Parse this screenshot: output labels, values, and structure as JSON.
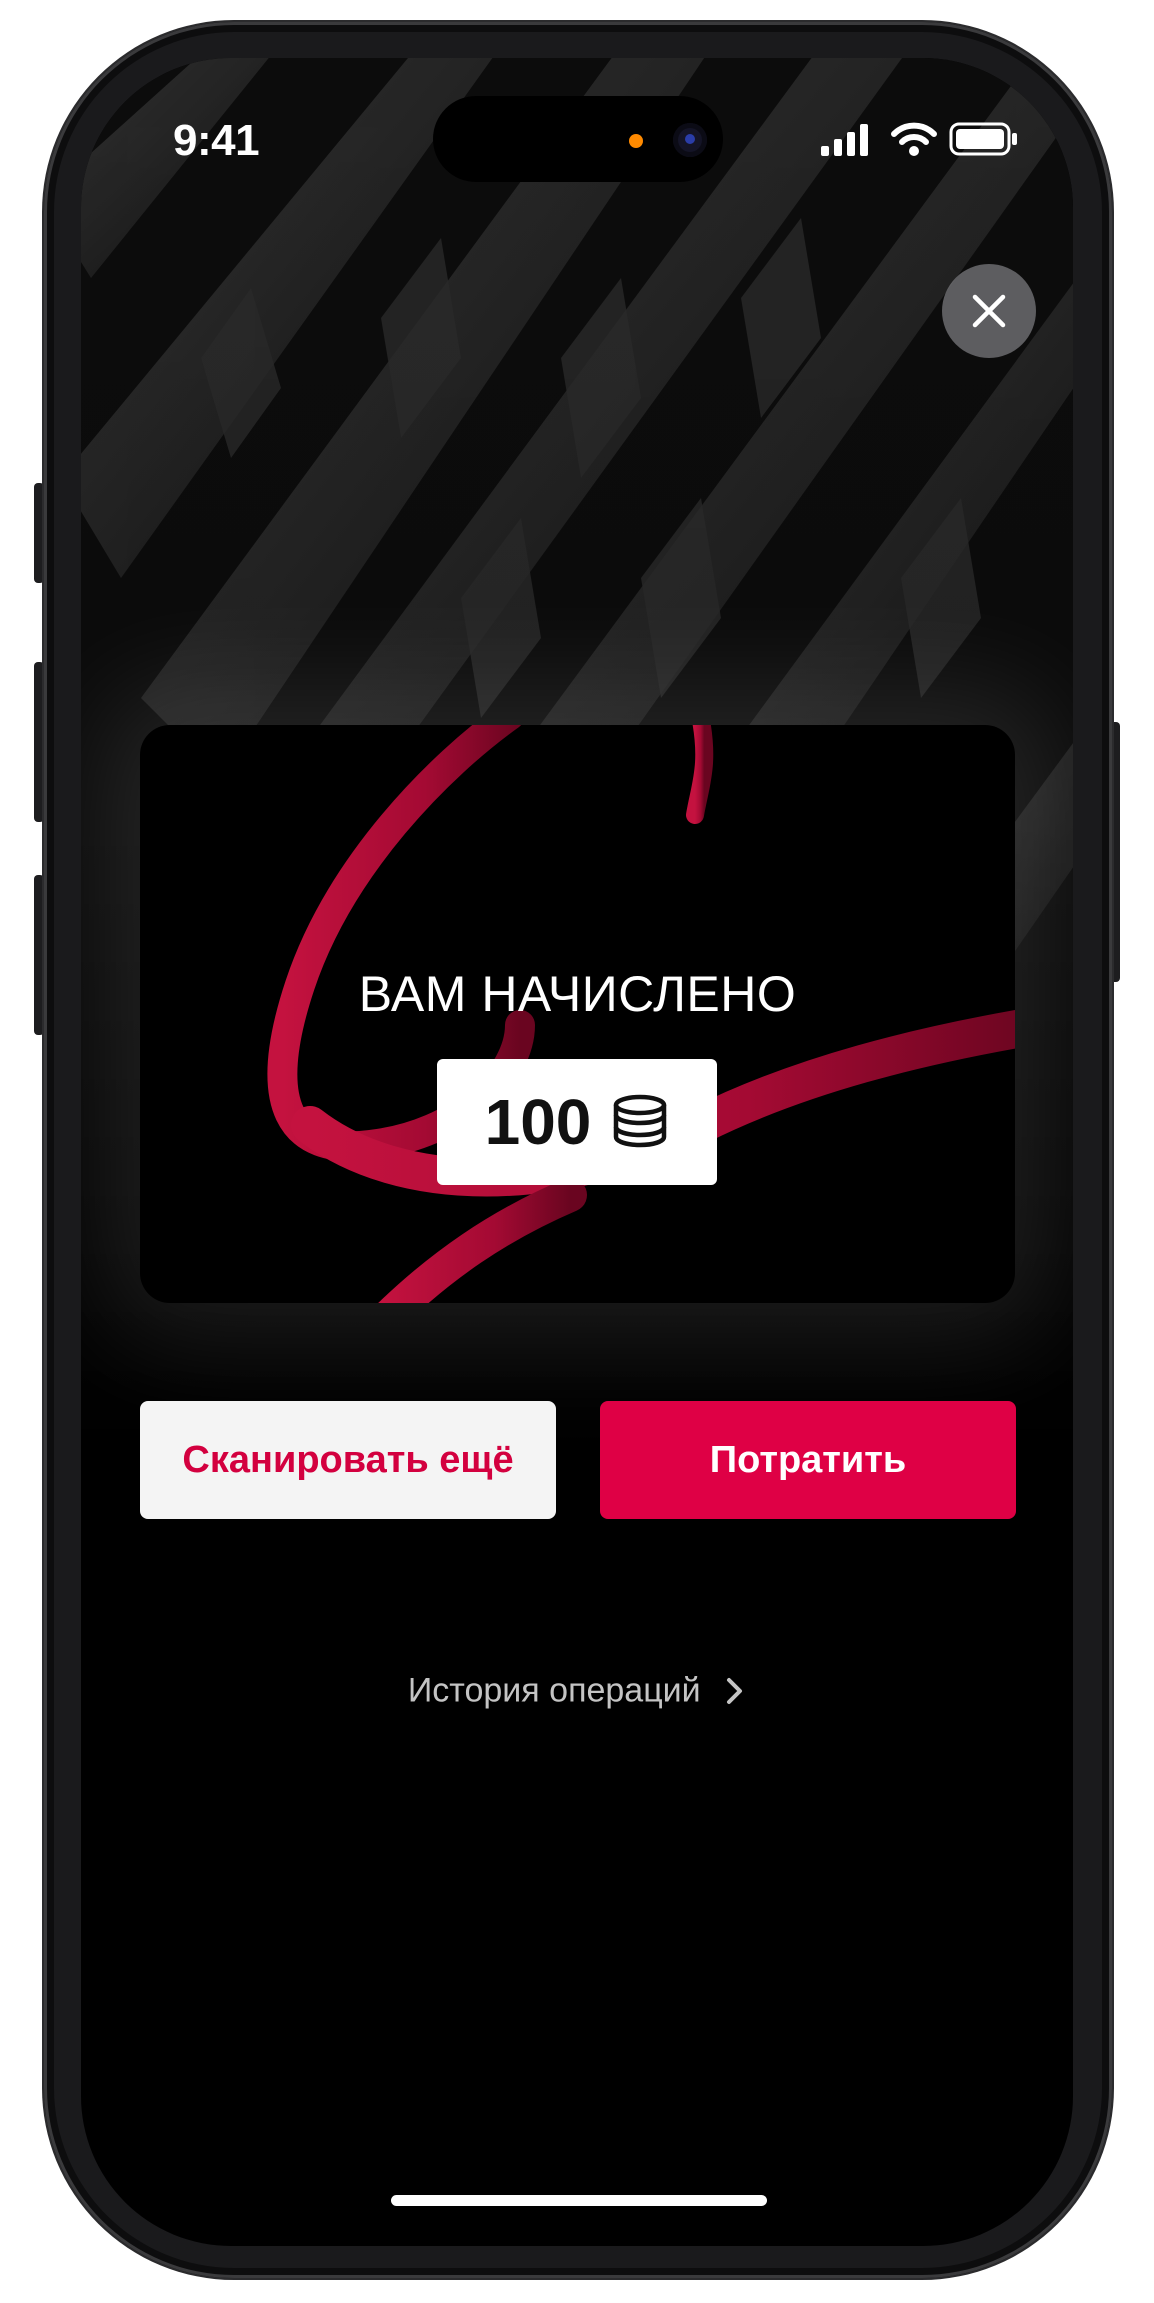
{
  "status_bar": {
    "time": "9:41"
  },
  "icons": {
    "close": "close-icon",
    "coins": "coins-stack-icon",
    "chevron": "chevron-right-icon",
    "signal": "signal-icon",
    "wifi": "wifi-icon",
    "battery": "battery-icon"
  },
  "reward_card": {
    "headline": "ВАМ НАЧИСЛЕНО",
    "amount": "100"
  },
  "actions": {
    "scan_label": "Сканировать ещё",
    "spend_label": "Потратить"
  },
  "history_link": "История операций",
  "colors": {
    "accent": "#df0045",
    "accent_text": "#d3003f",
    "background": "#000000",
    "secondary_button": "#f4f4f4"
  }
}
